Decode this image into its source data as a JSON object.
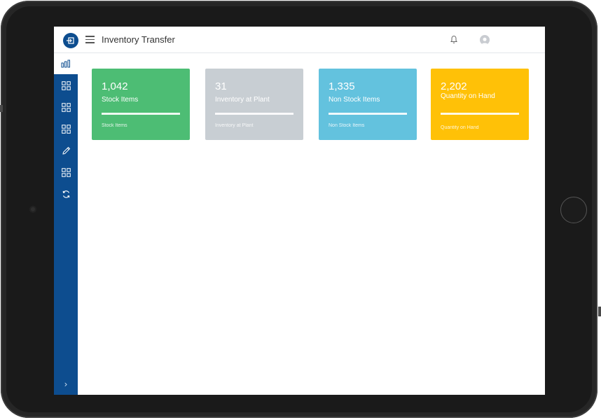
{
  "header": {
    "title": "Inventory Transfer",
    "icons": {
      "logo": "app-logo-icon",
      "menu": "hamburger-menu-icon",
      "notifications": "bell-icon",
      "user": "user-avatar-icon"
    }
  },
  "sidebar": {
    "items": [
      {
        "icon": "bar-chart-icon",
        "active": true
      },
      {
        "icon": "grid-icon"
      },
      {
        "icon": "grid-icon"
      },
      {
        "icon": "grid-icon"
      },
      {
        "icon": "pencil-icon"
      },
      {
        "icon": "grid-icon"
      },
      {
        "icon": "sync-icon"
      }
    ],
    "expand_icon": "chevron-right-icon",
    "expand_label": "›"
  },
  "cards": [
    {
      "value": "1,042",
      "label": "Stock Items",
      "footer": "Stock Items",
      "color": "#4dbd74"
    },
    {
      "value": "31",
      "label": "Inventory at Plant",
      "footer": "Inventory at Plant",
      "color": "#c8ced3"
    },
    {
      "value": "1,335",
      "label": "Non Stock Items",
      "footer": "Non Stock Items",
      "color": "#63c2de"
    },
    {
      "value": "2,202",
      "label": "Quantity on Hand",
      "footer": "Quantity on Hand",
      "color": "#ffc107"
    }
  ],
  "colors": {
    "sidebar": "#0d4d8f",
    "device_frame": "#262626"
  }
}
